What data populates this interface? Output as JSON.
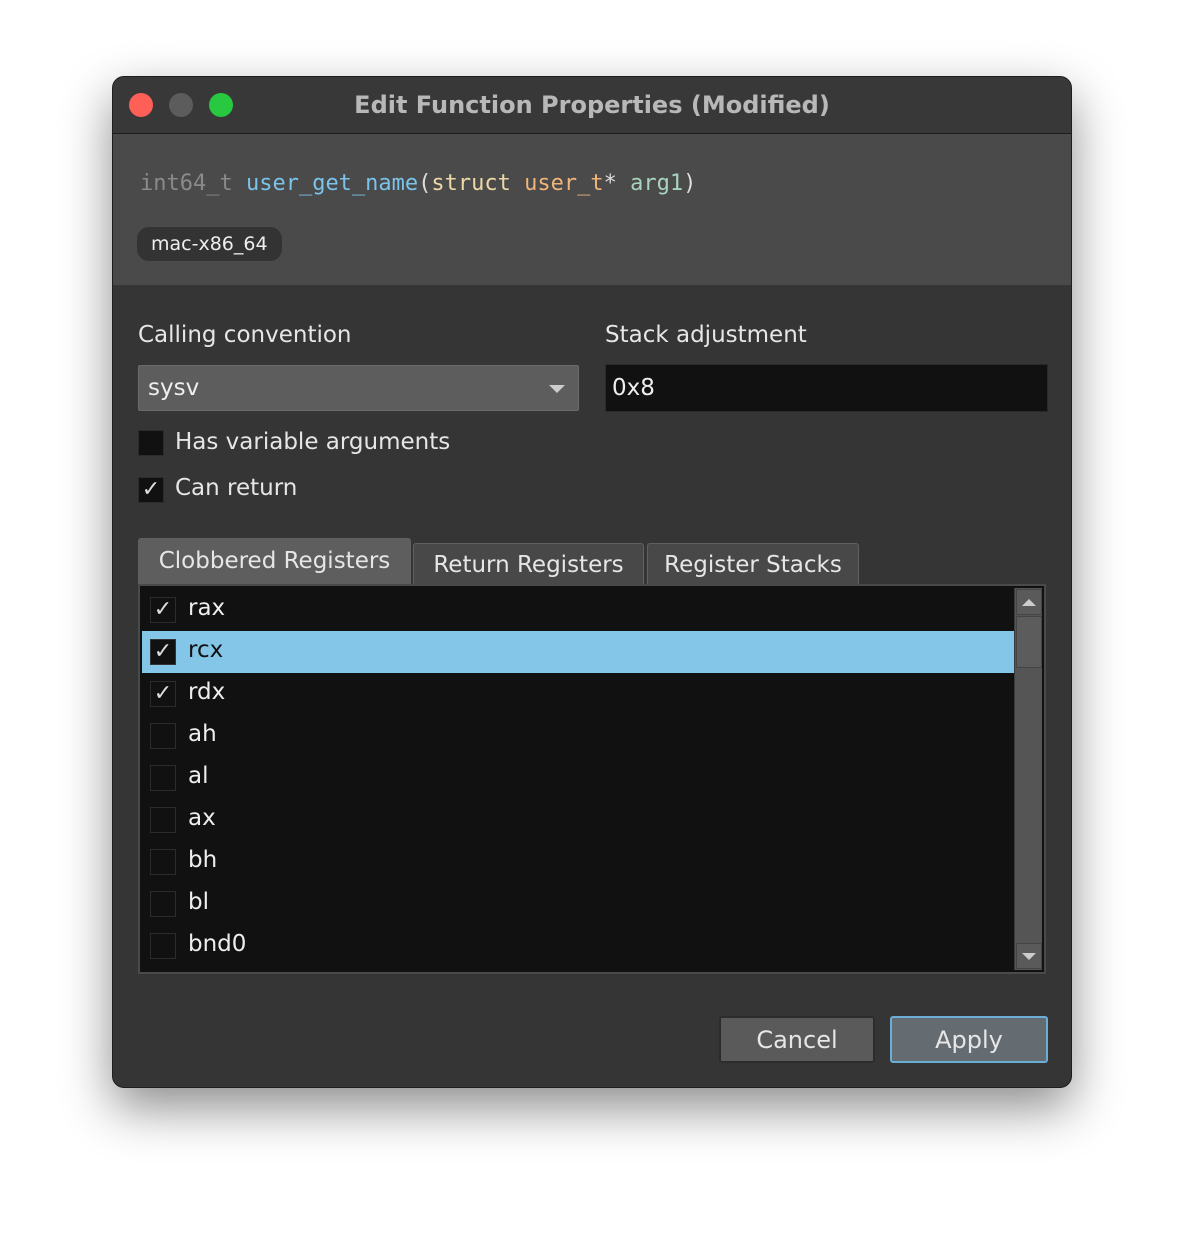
{
  "window": {
    "title": "Edit Function Properties (Modified)",
    "traffic_lights": {
      "close": "#fe5f57",
      "minimize": "#5c5c5c",
      "zoom": "#28c840"
    }
  },
  "header": {
    "signature": [
      {
        "text": "int64_t ",
        "color": "#8a8a8a"
      },
      {
        "text": "user_get_name",
        "color": "#7ac3ea"
      },
      {
        "text": "(",
        "color": "#dddddd"
      },
      {
        "text": "struct ",
        "color": "#ecd9a6"
      },
      {
        "text": "user_t",
        "color": "#f0b47a"
      },
      {
        "text": "* ",
        "color": "#dddddd"
      },
      {
        "text": "arg1",
        "color": "#a8d4bd"
      },
      {
        "text": ")",
        "color": "#dddddd"
      }
    ],
    "platform": "mac-x86_64"
  },
  "calling_convention": {
    "label": "Calling convention",
    "value": "sysv"
  },
  "stack_adjustment": {
    "label": "Stack adjustment",
    "value": "0x8"
  },
  "options": [
    {
      "label": "Has variable arguments",
      "checked": false
    },
    {
      "label": "Can return",
      "checked": true
    }
  ],
  "tabs": [
    {
      "label": "Clobbered Registers",
      "active": true
    },
    {
      "label": "Return Registers",
      "active": false
    },
    {
      "label": "Register Stacks",
      "active": false
    }
  ],
  "registers": [
    {
      "name": "rax",
      "checked": true,
      "selected": false
    },
    {
      "name": "rcx",
      "checked": true,
      "selected": true
    },
    {
      "name": "rdx",
      "checked": true,
      "selected": false
    },
    {
      "name": "ah",
      "checked": false,
      "selected": false
    },
    {
      "name": "al",
      "checked": false,
      "selected": false
    },
    {
      "name": "ax",
      "checked": false,
      "selected": false
    },
    {
      "name": "bh",
      "checked": false,
      "selected": false
    },
    {
      "name": "bl",
      "checked": false,
      "selected": false
    },
    {
      "name": "bnd0",
      "checked": false,
      "selected": false
    }
  ],
  "buttons": {
    "cancel": "Cancel",
    "apply": "Apply"
  },
  "colors": {
    "selection": "#84c6e8",
    "focus_border": "#6aaed6"
  }
}
